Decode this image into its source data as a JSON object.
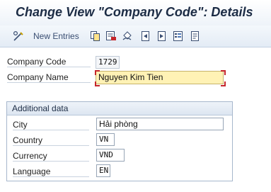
{
  "window": {
    "title": "Change View \"Company Code\": Details"
  },
  "toolbar": {
    "new_entries_label": "New Entries",
    "icons": [
      "edit-glasses-icon",
      "copy-icon",
      "delete-icon",
      "undo-icon",
      "previous-entry-icon",
      "next-entry-icon",
      "select-all-icon",
      "print-icon"
    ]
  },
  "header_fields": {
    "company_code": {
      "label": "Company Code",
      "value": "1729"
    },
    "company_name": {
      "label": "Company Name",
      "value": "Nguyen Kim Tien"
    }
  },
  "additional_data": {
    "title": "Additional data",
    "city": {
      "label": "City",
      "value": "Hải phòng"
    },
    "country": {
      "label": "Country",
      "value": "VN"
    },
    "currency": {
      "label": "Currency",
      "value": "VND"
    },
    "language": {
      "label": "Language",
      "value": "EN"
    }
  },
  "colors": {
    "title_text": "#1c2c45",
    "focused_field_bg": "#fff2b5",
    "focus_corner": "#c5262a",
    "toolbar_bg": "#e3ebf5"
  }
}
